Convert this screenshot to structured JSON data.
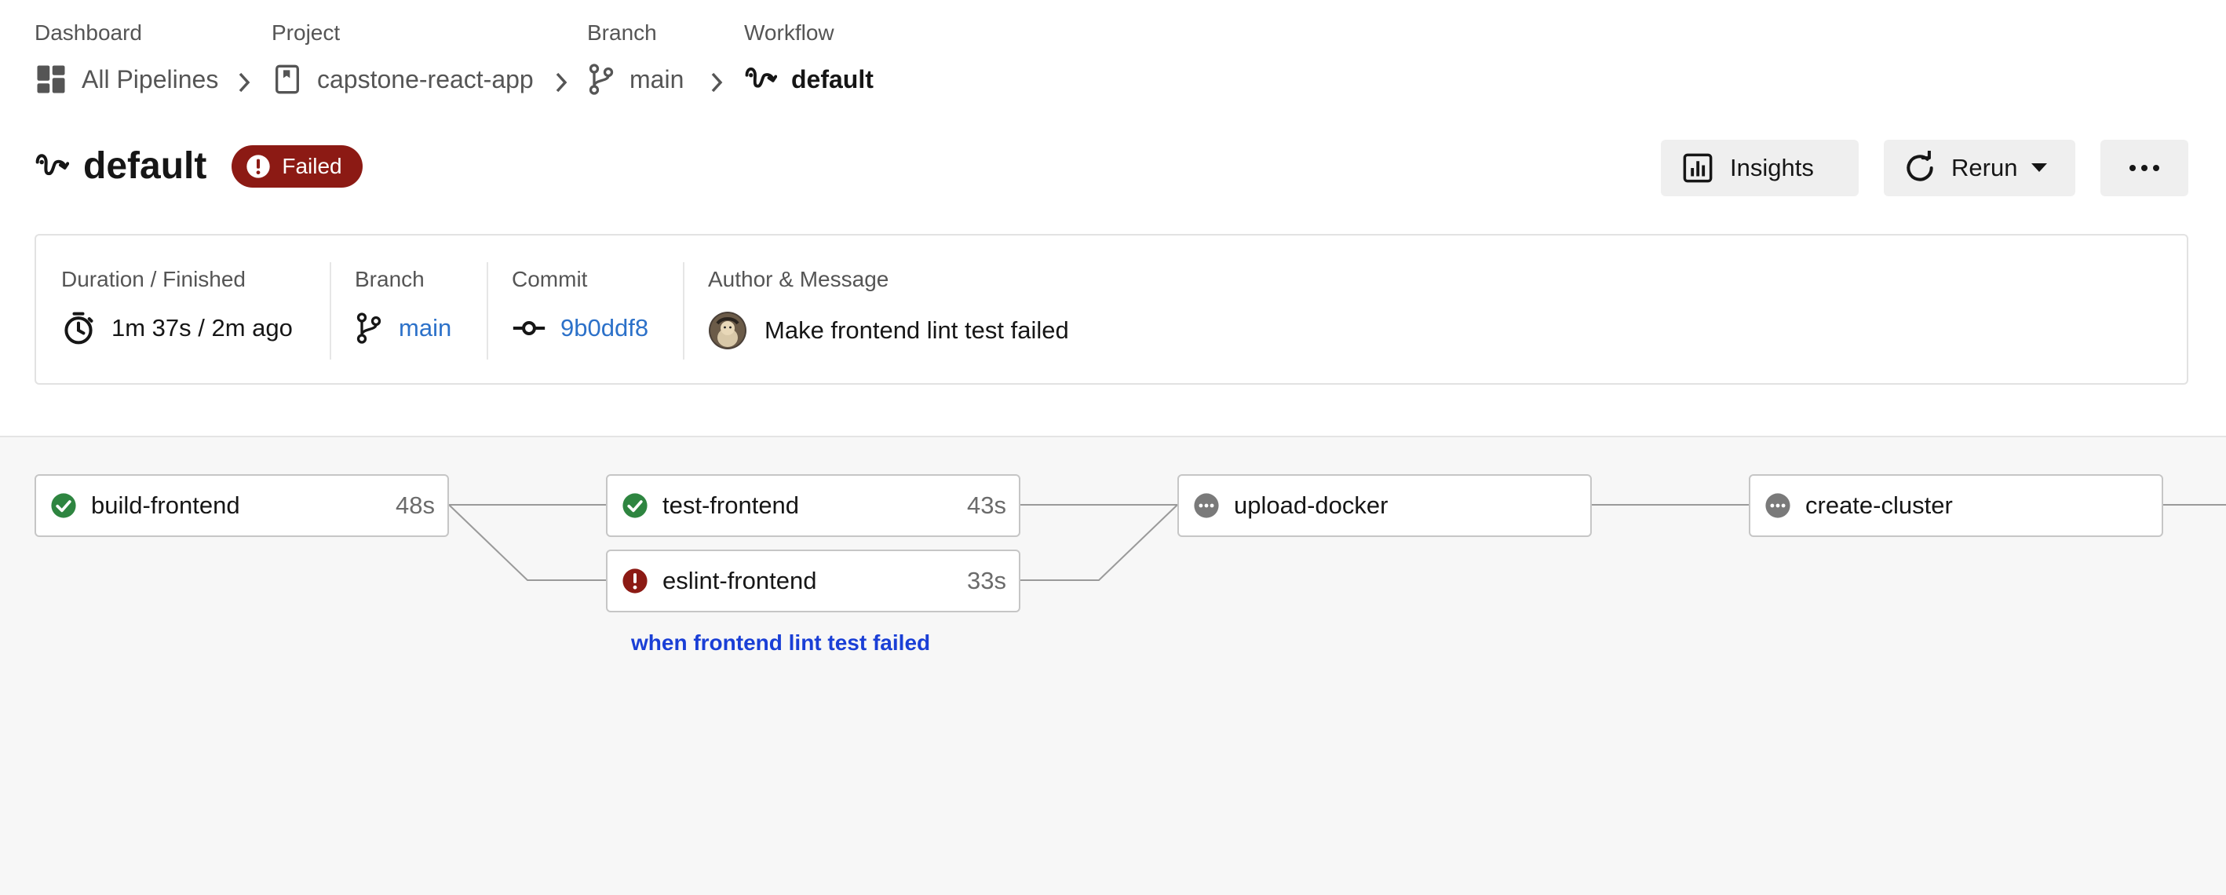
{
  "breadcrumb": [
    {
      "label": "Dashboard",
      "value": "All Pipelines",
      "icon": "dashboard-icon"
    },
    {
      "label": "Project",
      "value": "capstone-react-app",
      "icon": "project-icon"
    },
    {
      "label": "Branch",
      "value": "main",
      "icon": "branch-icon"
    },
    {
      "label": "Workflow",
      "value": "default",
      "icon": "workflow-icon"
    }
  ],
  "header": {
    "title": "default",
    "status": "Failed",
    "status_color": "#8c1a14",
    "insights_label": "Insights",
    "rerun_label": "Rerun"
  },
  "info": {
    "duration_label": "Duration / Finished",
    "duration_value": "1m 37s / 2m ago",
    "branch_label": "Branch",
    "branch_value": "main",
    "commit_label": "Commit",
    "commit_value": "9b0ddf8",
    "author_label": "Author & Message",
    "message": "Make frontend lint test failed"
  },
  "jobs": [
    {
      "name": "build-frontend",
      "duration": "48s",
      "status": "success"
    },
    {
      "name": "test-frontend",
      "duration": "43s",
      "status": "success"
    },
    {
      "name": "eslint-frontend",
      "duration": "33s",
      "status": "failed"
    },
    {
      "name": "upload-docker",
      "duration": "",
      "status": "pending"
    },
    {
      "name": "create-cluster",
      "duration": "",
      "status": "pending"
    }
  ],
  "approval_text": "when frontend lint test failed",
  "colors": {
    "success": "#2e8540",
    "failed": "#8c1a14",
    "pending": "#7a7a7a",
    "link": "#2c71c9",
    "approval": "#1a3fd6"
  }
}
